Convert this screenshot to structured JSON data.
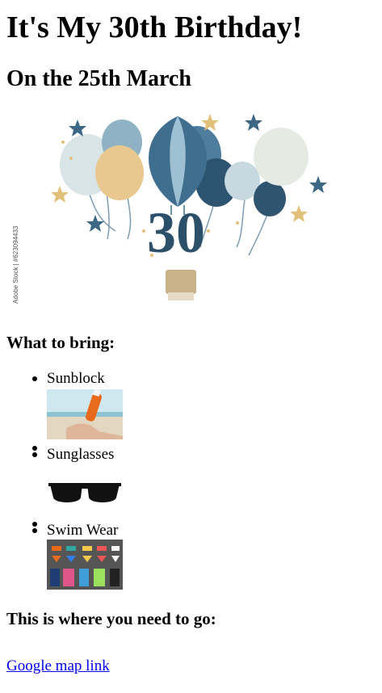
{
  "page": {
    "title": "It's My 30th Birthday!",
    "date_heading": "On the 25th March",
    "hero_image": {
      "icon": "birthday-balloons-30-image",
      "number_text": "30",
      "watermark": "Adobe Stock | #623094433"
    },
    "bring_heading": "What to bring:",
    "items": [
      {
        "label": "Sunblock",
        "image": "sunblock-image"
      },
      {
        "label": "Sunglasses",
        "image": "sunglasses-image"
      },
      {
        "label": "Swim Wear",
        "image": "swimwear-image"
      }
    ],
    "go_heading": "This is where you need to go:",
    "map_link_text": "Google map link"
  }
}
